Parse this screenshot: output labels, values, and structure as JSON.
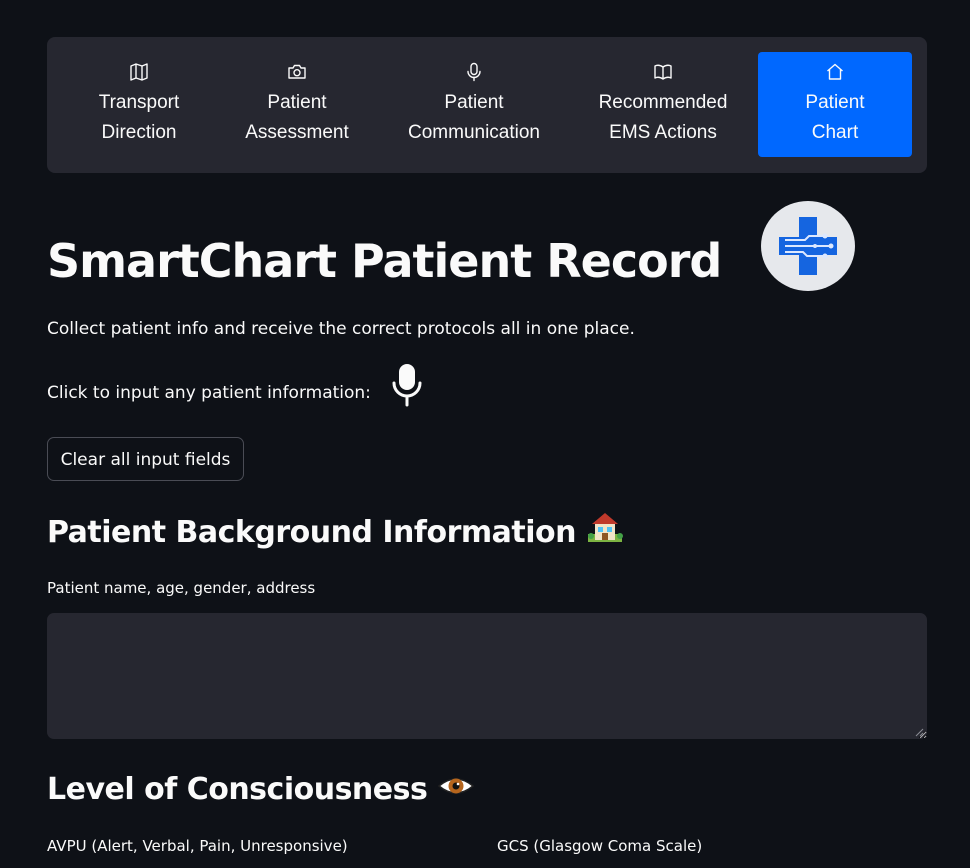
{
  "nav": {
    "items": [
      {
        "label": "Transport\nDirection",
        "icon": "map-icon",
        "active": false
      },
      {
        "label": "Patient\nAssessment",
        "icon": "camera-icon",
        "active": false
      },
      {
        "label": "Patient\nCommunication",
        "icon": "microphone-icon",
        "active": false
      },
      {
        "label": "Recommended\nEMS Actions",
        "icon": "book-icon",
        "active": false
      },
      {
        "label": "Patient\nChart",
        "icon": "house-icon",
        "active": true
      }
    ],
    "active_color": "#0068ff"
  },
  "page": {
    "title": "SmartChart Patient Record",
    "logo_icon": "medical-cross-circuit-icon",
    "subtitle": "Collect patient info and receive the correct protocols all in one place.",
    "voice_prompt": "Click to input any patient information:",
    "voice_icon": "microphone-icon",
    "clear_button": "Clear all input fields"
  },
  "sections": {
    "background": {
      "heading": "Patient Background Information",
      "emoji": "house-with-garden-icon",
      "field_label": "Patient name, age, gender, address",
      "field_value": ""
    },
    "consciousness": {
      "heading": "Level of Consciousness",
      "emoji": "eye-icon",
      "avpu_label": "AVPU (Alert, Verbal, Pain, Unresponsive)",
      "gcs_label": "GCS (Glasgow Coma Scale)"
    }
  },
  "colors": {
    "background": "#0e1117",
    "panel": "#262730",
    "accent": "#0068ff",
    "text": "#fafafa"
  }
}
